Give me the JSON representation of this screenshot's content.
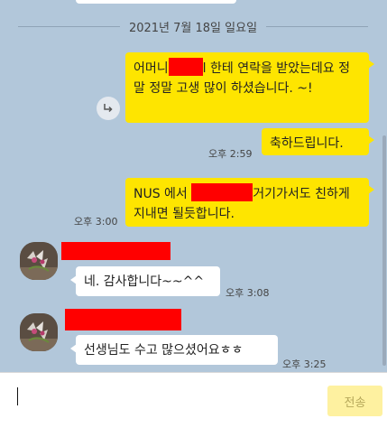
{
  "date_divider": "2021년 7월 18일 일요일",
  "messages": [
    {
      "sender": "me",
      "segments": [
        "어머니",
        "",
        "l 한테 연락을 받았는데요 정말 정말 고생 많이 하셨습니다. ~!"
      ]
    },
    {
      "sender": "me",
      "text": "축하드립니다.",
      "time": "오후 2:59"
    },
    {
      "sender": "me",
      "segments": [
        "NUS 에서 ",
        "",
        "거기가서도 친하게 지내면 될듯합니다."
      ],
      "time": "오후 3:00"
    },
    {
      "sender": "them",
      "text": "네. 감사합니다~~^^",
      "time": "오후 3:08"
    },
    {
      "sender": "them",
      "text": "선생님도 수고 많으셨어요ㅎㅎ",
      "time": "오후 3:25"
    }
  ],
  "icons": {
    "share": "share-arrow-icon",
    "avatar": "profile-avatar-icon"
  },
  "input": {
    "placeholder": "",
    "value": ""
  },
  "send_button": "전송",
  "colors": {
    "background": "#b2c7da",
    "my_bubble": "#fee500",
    "their_bubble": "#ffffff",
    "send_button_disabled": "#fef1a0",
    "redaction": "#ff0000"
  }
}
